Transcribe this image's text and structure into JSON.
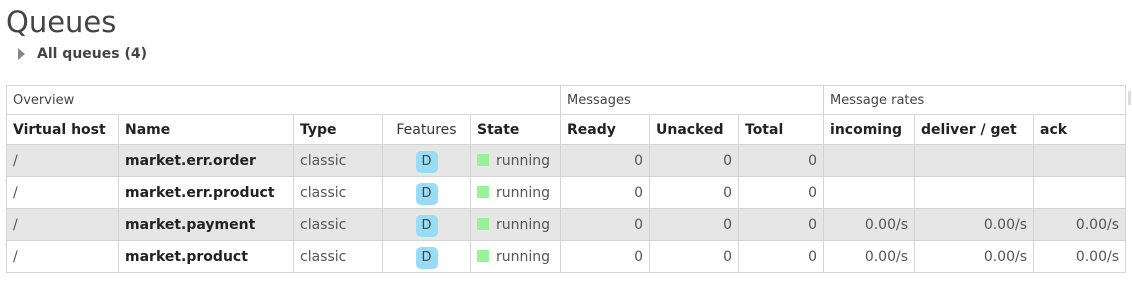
{
  "page": {
    "title": "Queues",
    "section_label": "All queues (4)"
  },
  "table": {
    "groups": {
      "overview": "Overview",
      "messages": "Messages",
      "message_rates": "Message rates"
    },
    "columns": {
      "virtual_host": "Virtual host",
      "name": "Name",
      "type": "Type",
      "features": "Features",
      "state": "State",
      "ready": "Ready",
      "unacked": "Unacked",
      "total": "Total",
      "incoming": "incoming",
      "deliver_get": "deliver / get",
      "ack": "ack"
    },
    "rows": [
      {
        "vhost": "/",
        "name": "market.err.order",
        "type": "classic",
        "feature": "D",
        "state": "running",
        "ready": "0",
        "unacked": "0",
        "total": "0",
        "incoming": "",
        "deliver_get": "",
        "ack": ""
      },
      {
        "vhost": "/",
        "name": "market.err.product",
        "type": "classic",
        "feature": "D",
        "state": "running",
        "ready": "0",
        "unacked": "0",
        "total": "0",
        "incoming": "",
        "deliver_get": "",
        "ack": ""
      },
      {
        "vhost": "/",
        "name": "market.payment",
        "type": "classic",
        "feature": "D",
        "state": "running",
        "ready": "0",
        "unacked": "0",
        "total": "0",
        "incoming": "0.00/s",
        "deliver_get": "0.00/s",
        "ack": "0.00/s"
      },
      {
        "vhost": "/",
        "name": "market.product",
        "type": "classic",
        "feature": "D",
        "state": "running",
        "ready": "0",
        "unacked": "0",
        "total": "0",
        "incoming": "0.00/s",
        "deliver_get": "0.00/s",
        "ack": "0.00/s"
      }
    ]
  },
  "colors": {
    "running_state": "#98f398",
    "feature_badge": "#99ddf5",
    "odd_row": "#e6e6e6"
  }
}
